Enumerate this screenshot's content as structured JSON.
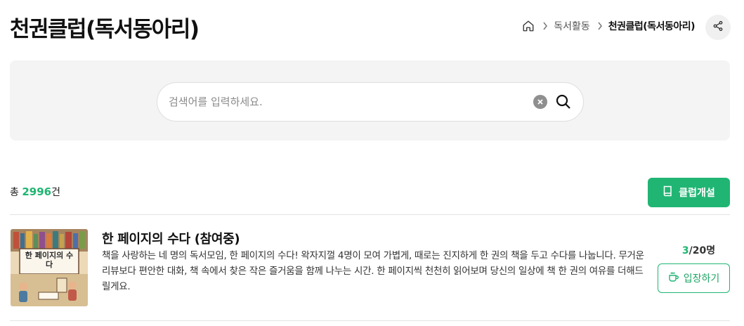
{
  "page": {
    "title": "천권클럽(독서동아리)"
  },
  "breadcrumb": {
    "home_icon": "home-icon",
    "items": [
      "독서활동",
      "천권클럽(독서동아리)"
    ]
  },
  "share": {
    "icon": "share-icon"
  },
  "search": {
    "value": "",
    "placeholder": "검색어를 입력하세요.",
    "clear_icon": "clear-circle-icon",
    "search_icon": "search-icon"
  },
  "summary": {
    "prefix": "총 ",
    "count": "2996",
    "suffix": "건"
  },
  "create_button": {
    "label": "클럽개설",
    "icon": "book-icon"
  },
  "clubs": [
    {
      "title": "한 페이지의 수다 (참여중)",
      "description": "책을 사랑하는 네 명의 독서모임, 한 페이지의 수다! 왁자지껄 4명이 모여 가볍게, 때로는 진지하게 한 권의 책을 두고 수다를 나눕니다. 무거운 리뷰보다 편안한 대화, 책 속에서 찾은 작은 즐거움을 함께 나누는 시간. 한 페이지씩 천천히 읽어보며 당신의 일상에 책 한 권의 여유를 더해드릴게요.",
      "cover_title": "한 페이지의 수다",
      "members_current": "3",
      "members_total": "/20명",
      "enter_label": "입장하기",
      "enter_icon": "cup-icon"
    }
  ],
  "colors": {
    "accent": "#20b573",
    "panel_bg": "#f4f4f4"
  }
}
